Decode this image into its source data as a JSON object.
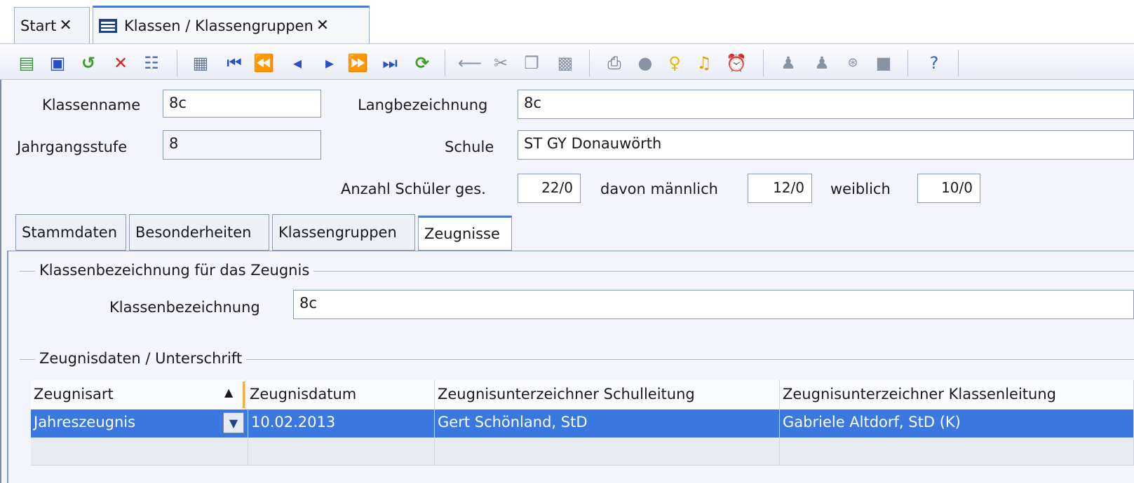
{
  "tabs": {
    "start": "Start",
    "klassen": "Klassen / Klassengruppen",
    "close": "✕"
  },
  "toolbar": {
    "icons": [
      "new-document",
      "save",
      "undo",
      "delete",
      "list",
      "calculator",
      "first",
      "previous-page",
      "previous",
      "next",
      "next-page",
      "last",
      "refresh",
      "arrow-left",
      "scissors",
      "copy",
      "paste",
      "print",
      "disk",
      "lightbulb",
      "bell",
      "alarm-clock",
      "people",
      "people",
      "settings",
      "document",
      "help"
    ]
  },
  "form": {
    "klassenname_label": "Klassenname",
    "klassenname_value": "8c",
    "jahrgangsstufe_label": "Jahrgangsstufe",
    "jahrgangsstufe_value": "8",
    "langbezeichnung_label": "Langbezeichnung",
    "langbezeichnung_value": "8c",
    "schule_label": "Schule",
    "schule_value": "ST GY Donauwörth",
    "anzahl_label": "Anzahl Schüler ges.",
    "anzahl_value": "22/0",
    "maennlich_label": "davon männlich",
    "maennlich_value": "12/0",
    "weiblich_label": "weiblich",
    "weiblich_value": "10/0"
  },
  "subtabs": [
    "Stammdaten",
    "Besonderheiten",
    "Klassengruppen",
    "Zeugnisse"
  ],
  "zeugnis": {
    "group1_title": "Klassenbezeichnung für das Zeugnis",
    "klassenbez_label": "Klassenbezeichnung",
    "klassenbez_value": "8c",
    "group2_title": "Zeugnisdaten / Unterschrift"
  },
  "grid": {
    "columns": [
      "Zeugnisart",
      "Zeugnisdatum",
      "Zeugnisunterzeichner Schulleitung",
      "Zeugnisunterzeichner Klassenleitung"
    ],
    "sort_indicator": "▲",
    "rows": [
      {
        "art": "Jahreszeugnis",
        "datum": "10.02.2013",
        "schulleitung": "Gert Schönland, StD",
        "klassenleitung": "Gabriele Altdorf, StD (K)"
      }
    ]
  }
}
